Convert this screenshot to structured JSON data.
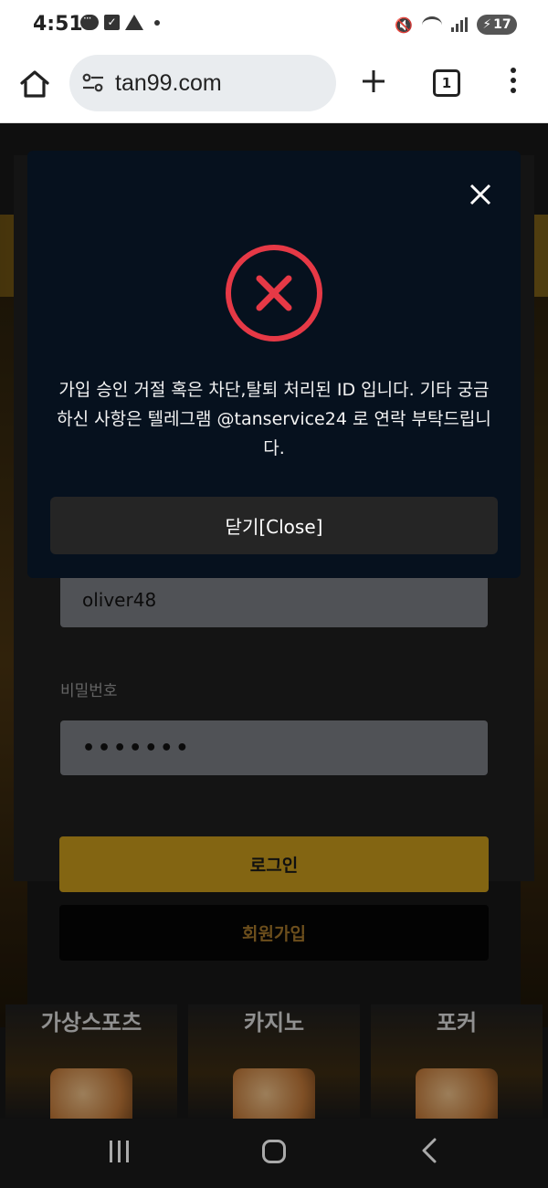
{
  "status_bar": {
    "time": "4:51",
    "battery": "17"
  },
  "browser": {
    "url": "tan99.com",
    "tab_count": "1"
  },
  "login_form": {
    "username_value": "oliver48",
    "password_label": "비밀번호",
    "password_value": "•••••••",
    "login_button": "로그인",
    "signup_button": "회원가입"
  },
  "categories": [
    {
      "label": "가상스포츠"
    },
    {
      "label": "카지노"
    },
    {
      "label": "포커"
    }
  ],
  "modal": {
    "message": "가입 승인 거절 혹은 차단,탈퇴 처리된 ID 입니다. 기타 궁금하신 사항은 텔레그램 @tanservice24 로 연락 부탁드립니다.",
    "close_button": "닫기[Close]",
    "error_color": "#e63946"
  },
  "colors": {
    "accent_gold": "#c99b1c",
    "modal_bg": "#06111e"
  }
}
